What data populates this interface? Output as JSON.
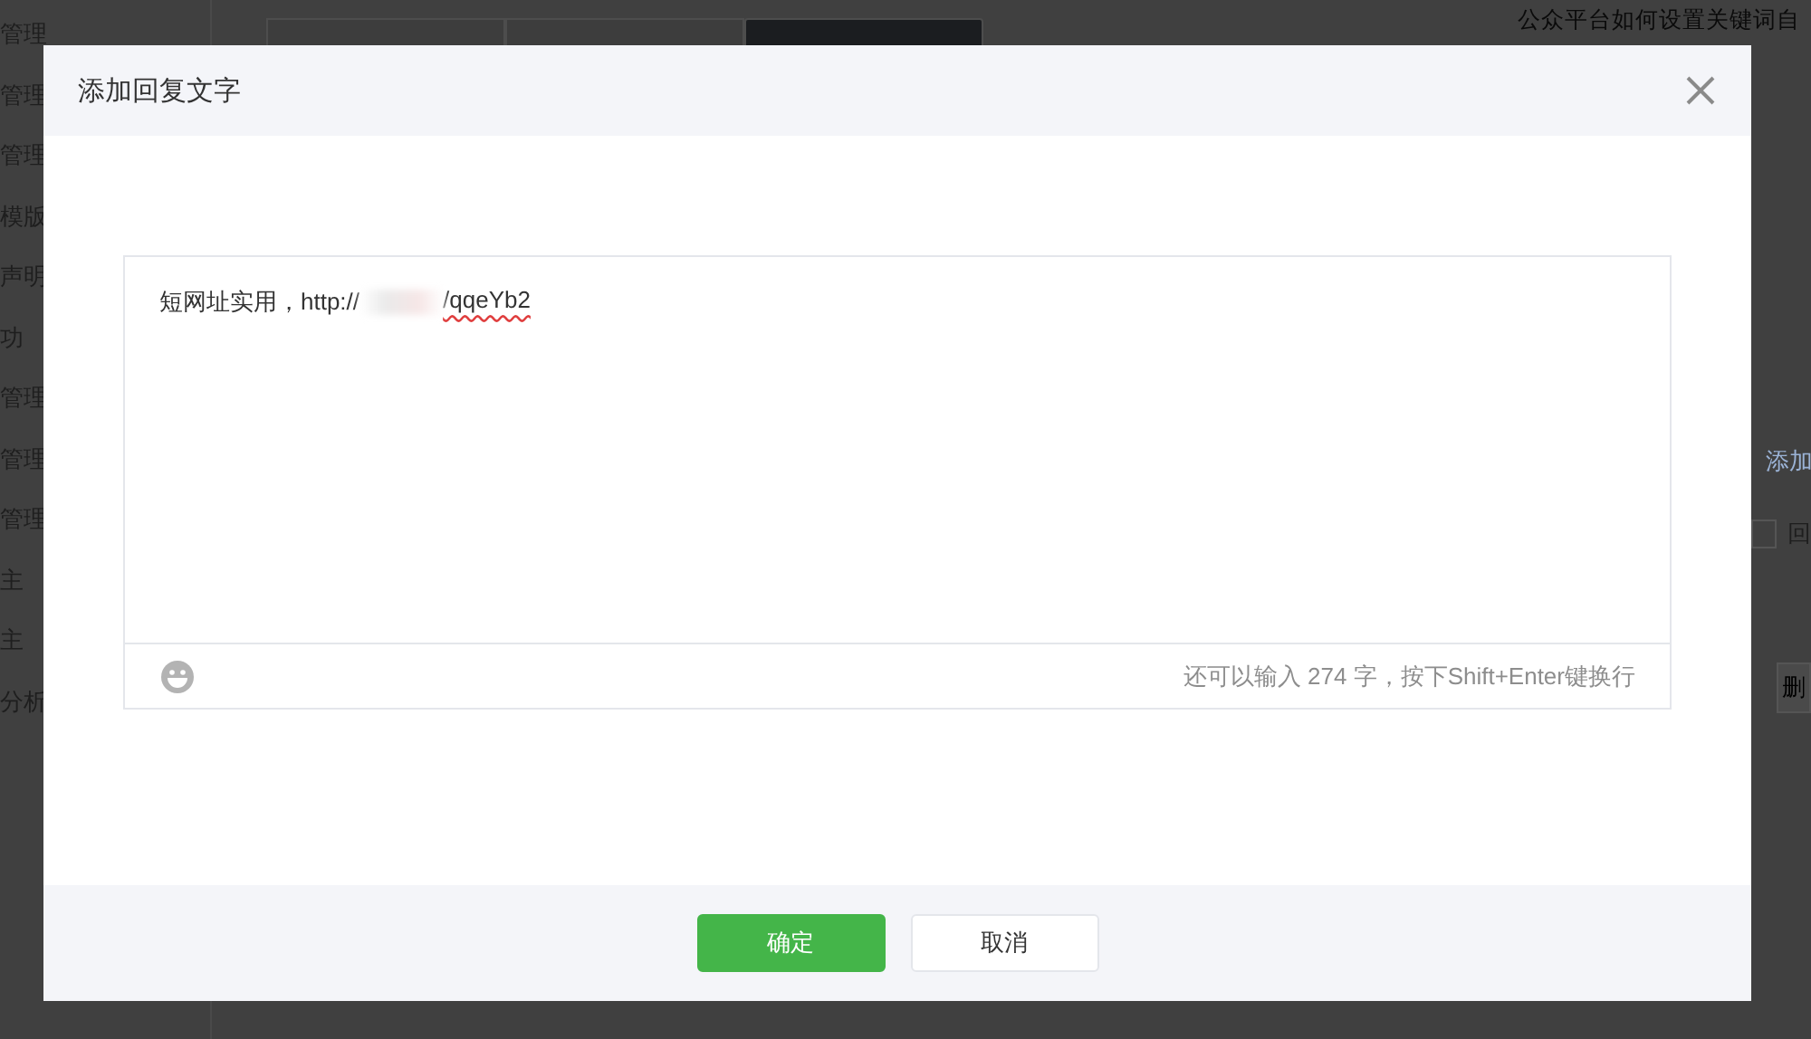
{
  "background": {
    "sidebar_items": [
      "管理",
      "管理",
      "管理",
      "模版",
      "声明",
      "功",
      "管理",
      "管理",
      "管理",
      "主",
      "主",
      "分析"
    ],
    "tabs": [
      {
        "selected": false
      },
      {
        "selected": false
      },
      {
        "selected": true
      }
    ],
    "heading": "公众平台如何设置关键词自",
    "right": {
      "link": "添加",
      "checkbox": {
        "checked": false,
        "label": "回"
      },
      "button": "删"
    }
  },
  "dialog": {
    "title": "添加回复文字",
    "editor": {
      "value_start": "短网址实用，http://",
      "value_end": "/qqeYb2",
      "redacted": true,
      "counter": "还可以输入 274 字，按下Shift+Enter键换行"
    },
    "buttons": [
      {
        "label": "确定",
        "kind": "primary"
      },
      {
        "label": "取消",
        "kind": "secondary"
      }
    ]
  }
}
